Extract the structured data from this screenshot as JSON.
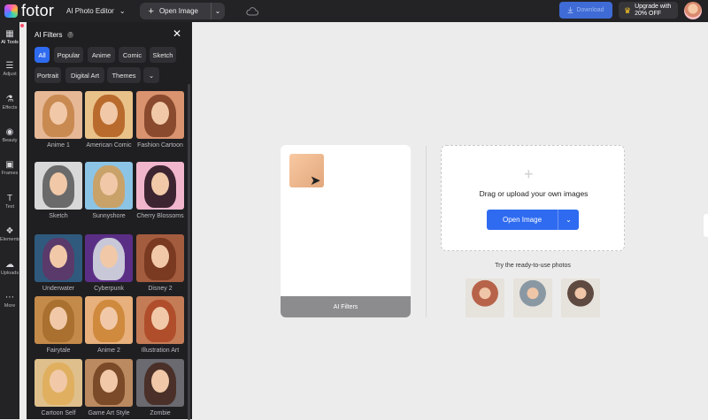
{
  "header": {
    "logo_text": "fotor",
    "editor_menu": "AI Photo Editor",
    "open_image": "Open Image",
    "download": "Download",
    "upgrade_line1": "Upgrade with",
    "upgrade_line2": "20% OFF"
  },
  "rail": [
    {
      "label": "AI Tools",
      "icon": "grid-icon"
    },
    {
      "label": "Adjust",
      "icon": "sliders-icon"
    },
    {
      "label": "Effects",
      "icon": "flask-icon"
    },
    {
      "label": "Beauty",
      "icon": "eye-icon"
    },
    {
      "label": "Frames",
      "icon": "frame-icon"
    },
    {
      "label": "Text",
      "icon": "text-icon"
    },
    {
      "label": "Elements",
      "icon": "shapes-icon"
    },
    {
      "label": "Uploads",
      "icon": "cloud-upload-icon"
    },
    {
      "label": "More",
      "icon": "more-icon"
    }
  ],
  "panel": {
    "title": "AI Filters",
    "info": "?",
    "chips": [
      "All",
      "Popular",
      "Anime",
      "Comic",
      "Sketch",
      "Portrait",
      "Digital Art",
      "Themes"
    ],
    "filters": [
      {
        "name": "Anime 1",
        "bg": "#e6b896",
        "hair": "#c98a52"
      },
      {
        "name": "American Comic",
        "bg": "#e9c28a",
        "hair": "#b96b2d"
      },
      {
        "name": "Fashion Cartoon",
        "bg": "#d9936e",
        "hair": "#8a4a2e"
      },
      {
        "name": "Sketch",
        "bg": "#d8d8d8",
        "hair": "#6a6a6a"
      },
      {
        "name": "Sunnyshore",
        "bg": "#8cc4e6",
        "hair": "#c9a26a"
      },
      {
        "name": "Cherry Blossoms",
        "bg": "#f1b6cc",
        "hair": "#3d2431"
      },
      {
        "name": "Underwater",
        "bg": "#2f5a7d",
        "hair": "#5a3a6a"
      },
      {
        "name": "Cyberpunk",
        "bg": "#5b2e86",
        "hair": "#c8c8d8"
      },
      {
        "name": "Disney 2",
        "bg": "#a45c3f",
        "hair": "#7a3a22"
      },
      {
        "name": "Fairytale",
        "bg": "#c48a4a",
        "hair": "#a9702f"
      },
      {
        "name": "Anime 2",
        "bg": "#e7b07c",
        "hair": "#d08a3e"
      },
      {
        "name": "Illustration Art",
        "bg": "#c47c56",
        "hair": "#b04e2c"
      },
      {
        "name": "Cartoon Self",
        "bg": "#dfc08c",
        "hair": "#e0b060"
      },
      {
        "name": "Game Art Style",
        "bg": "#bb8a60",
        "hair": "#7b4a28"
      },
      {
        "name": "Zombie",
        "bg": "#6a6a70",
        "hair": "#4a3028"
      }
    ]
  },
  "canvas": {
    "preview_label": "AI Filters"
  },
  "upload": {
    "title": "Drag or upload your own images",
    "open_button": "Open Image",
    "try_text": "Try the ready-to-use photos",
    "samples": [
      {
        "bg": "#b7634a"
      },
      {
        "bg": "#8a98a3"
      },
      {
        "bg": "#5e4a40"
      }
    ]
  }
}
